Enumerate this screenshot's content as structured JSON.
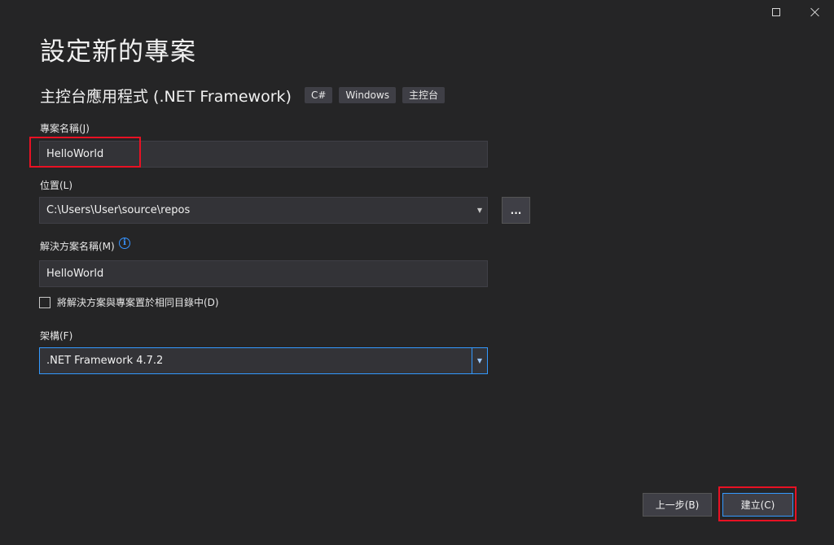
{
  "window": {
    "title": "設定新的專案",
    "controls": {
      "maximize_icon": "maximize-icon",
      "close_icon": "close-icon"
    }
  },
  "template": {
    "name": "主控台應用程式 (.NET Framework)",
    "tags": [
      "C#",
      "Windows",
      "主控台"
    ]
  },
  "project_name": {
    "label": "專案名稱(J)",
    "value": "HelloWorld"
  },
  "location": {
    "label": "位置(L)",
    "value": "C:\\Users\\User\\source\\repos",
    "browse_label": "..."
  },
  "solution_name": {
    "label": "解決方案名稱(M)",
    "value": "HelloWorld",
    "info_icon": "info-icon",
    "info_glyph": "i"
  },
  "same_dir_checkbox": {
    "label": "將解決方案與專案置於相同目錄中(D)",
    "checked": false
  },
  "framework": {
    "label": "架構(F)",
    "value": ".NET Framework 4.7.2"
  },
  "buttons": {
    "back": "上一步(B)",
    "create": "建立(C)"
  },
  "colors": {
    "background": "#252526",
    "field": "#333337",
    "accent": "#3399ff",
    "highlight": "#e81123"
  }
}
